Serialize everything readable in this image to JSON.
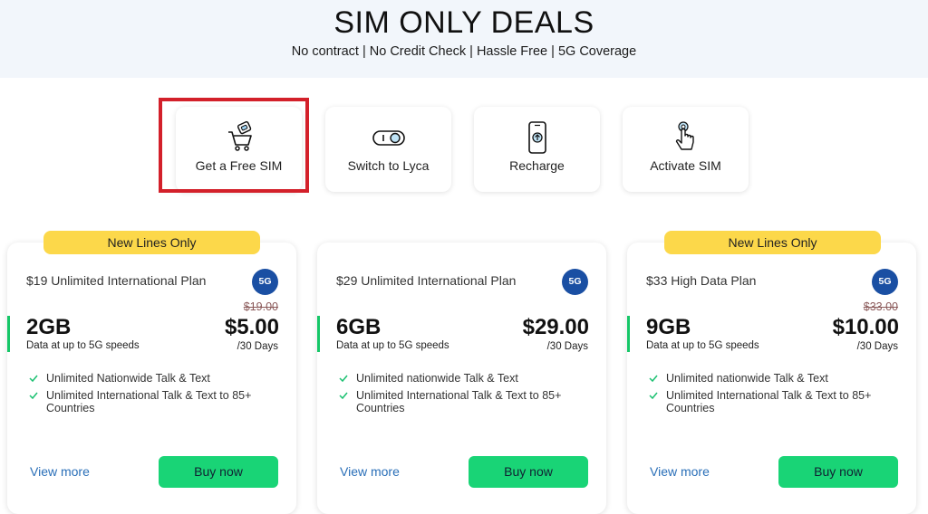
{
  "hero": {
    "title": "SIM ONLY DEALS",
    "subtitle": "No contract | No Credit Check | Hassle Free | 5G Coverage"
  },
  "tiles": [
    {
      "label": "Get a Free SIM",
      "icon": "cart-sim-icon"
    },
    {
      "label": "Switch to Lyca",
      "icon": "toggle-switch-icon"
    },
    {
      "label": "Recharge",
      "icon": "phone-recharge-icon"
    },
    {
      "label": "Activate SIM",
      "icon": "tap-hand-icon"
    }
  ],
  "plans": [
    {
      "ribbon": "New Lines Only",
      "name": "$19 Unlimited International Plan",
      "badge": "5G",
      "data": "2GB",
      "data_desc": "Data at up to 5G speeds",
      "old_price": "$19.00",
      "price": "$5.00",
      "period": "/30 Days",
      "features": [
        "Unlimited Nationwide Talk & Text",
        "Unlimited International Talk & Text to 85+ Countries"
      ],
      "view_more": "View more",
      "buy": "Buy now"
    },
    {
      "ribbon": "",
      "name": "$29 Unlimited International Plan",
      "badge": "5G",
      "data": "6GB",
      "data_desc": "Data at up to 5G speeds",
      "old_price": "",
      "price": "$29.00",
      "period": "/30 Days",
      "features": [
        "Unlimited nationwide Talk & Text",
        "Unlimited International Talk & Text to 85+ Countries"
      ],
      "view_more": "View more",
      "buy": "Buy now"
    },
    {
      "ribbon": "New Lines Only",
      "name": "$33 High Data Plan",
      "badge": "5G",
      "data": "9GB",
      "data_desc": "Data at up to 5G speeds",
      "old_price": "$33.00",
      "price": "$10.00",
      "period": "/30 Days",
      "features": [
        "Unlimited nationwide Talk & Text",
        "Unlimited International Talk & Text to 85+ Countries"
      ],
      "view_more": "View more",
      "buy": "Buy now"
    }
  ],
  "colors": {
    "accent_green": "#19d476",
    "ribbon_yellow": "#fcd84a",
    "badge_blue": "#1a4fa3",
    "highlight_red": "#d3202a",
    "link_blue": "#2a6fb8"
  }
}
